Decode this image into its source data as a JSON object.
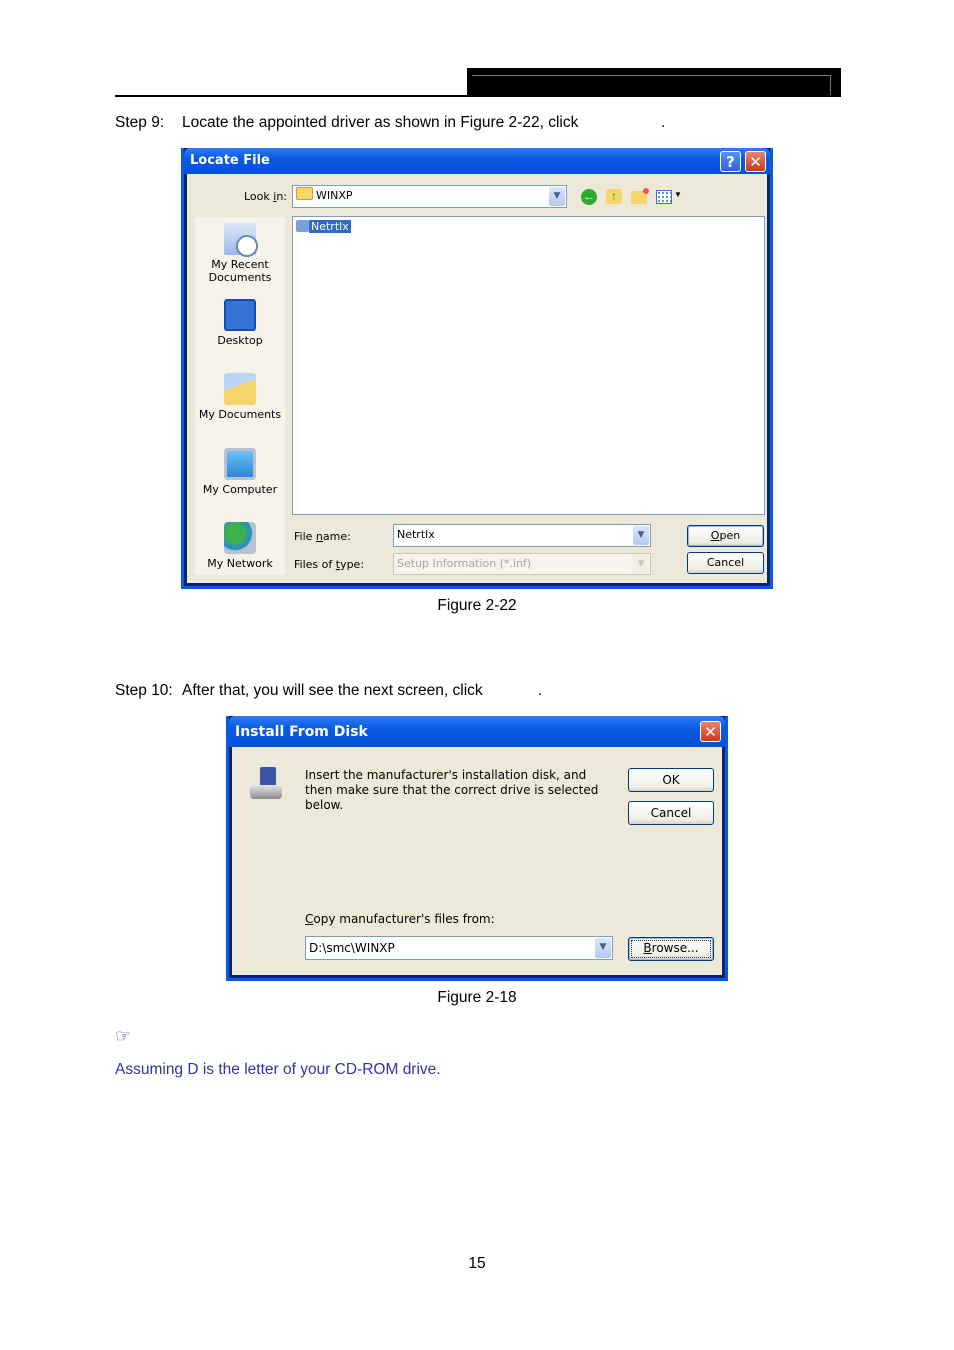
{
  "page": {
    "number": "15",
    "step9": {
      "prefix": "Step 9:",
      "text": "Locate the appointed driver as shown in Figure 2-22, click",
      "suffix": "."
    },
    "step10": {
      "prefix": "Step 10:",
      "text": "After that, you will see the next screen, click",
      "suffix": "."
    },
    "figure1_caption": "Figure 2-22",
    "figure2_caption": "Figure 2-18",
    "note_icon": "pointing-hand-icon",
    "note_text": "Assuming D is the letter of your CD-ROM drive.",
    "note_color": "#3333aa"
  },
  "locate_file": {
    "title": "Locate File",
    "help_button": "?",
    "close_button": "✕",
    "look_in_label": "Look in:",
    "look_in_value": "WINXP",
    "toolbar_icons": [
      "back-icon",
      "up-folder-icon",
      "new-folder-icon",
      "views-menu-icon"
    ],
    "places": [
      {
        "label": "My Recent Documents",
        "icon": "recent-documents-icon"
      },
      {
        "label": "Desktop",
        "icon": "desktop-icon"
      },
      {
        "label": "My Documents",
        "icon": "my-documents-icon"
      },
      {
        "label": "My Computer",
        "icon": "my-computer-icon"
      },
      {
        "label": "My Network",
        "icon": "my-network-icon"
      }
    ],
    "files": [
      {
        "name": "Netrtlx",
        "selected": true
      }
    ],
    "file_name_label": "File name:",
    "file_name_value": "Netrtlx",
    "file_type_label": "Files of type:",
    "file_type_value": "Setup Information (*.inf)",
    "open_button": "Open",
    "cancel_button": "Cancel"
  },
  "install_from_disk": {
    "title": "Install From Disk",
    "close_button": "✕",
    "message": "Insert the manufacturer's installation disk, and then make sure that the correct drive is selected below.",
    "ok_button": "OK",
    "cancel_button": "Cancel",
    "copy_label": "Copy manufacturer's files from:",
    "copy_value": "D:\\smc\\WINXP",
    "browse_button": "Browse..."
  }
}
